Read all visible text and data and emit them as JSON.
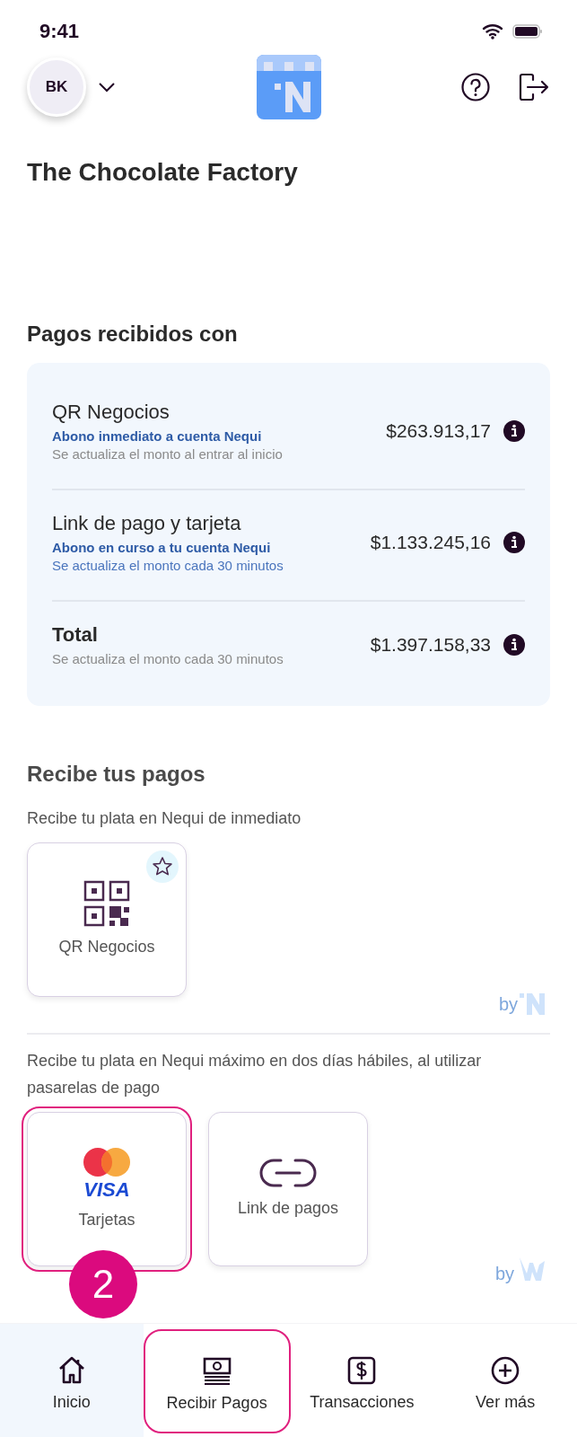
{
  "status_bar": {
    "time": "9:41"
  },
  "header": {
    "avatar_initials": "BK"
  },
  "business_name": "The Chocolate Factory",
  "payments": {
    "title": "Pagos recibidos con",
    "rows": [
      {
        "kind": "channel",
        "title": "QR Negocios",
        "amount": "$263.913,17",
        "notes": [
          {
            "text": "Abono inmediato a cuenta Nequi",
            "kind": "accent"
          },
          {
            "text": "Se actualiza el monto al entrar al inicio",
            "kind": "muted"
          }
        ]
      },
      {
        "kind": "channel",
        "title": "Link de pago y tarjeta",
        "amount": "$1.133.245,16",
        "notes": [
          {
            "text": "Abono en curso a tu cuenta Nequi",
            "kind": "accent"
          },
          {
            "text": "Se actualiza el monto cada 30 minutos",
            "kind": "link"
          }
        ]
      },
      {
        "kind": "total",
        "title": "Total",
        "amount": "$1.397.158,33",
        "notes": [
          {
            "text": "Se actualiza el monto cada 30 minutos",
            "kind": "muted"
          }
        ]
      }
    ]
  },
  "receive": {
    "title": "Recibe tus pagos",
    "groups": [
      {
        "description": "Recibe tu plata en Nequi de inmediato",
        "kind": "nequi",
        "by": "by",
        "options": [
          {
            "kind": "qr",
            "label": "QR Negocios",
            "favorite": true,
            "highlighted": false
          }
        ]
      },
      {
        "description": "Recibe tu plata en Nequi máximo en dos días hábiles, al utilizar pasarelas de pago",
        "kind": "wompi",
        "by": "by",
        "options": [
          {
            "kind": "cards",
            "label": "Tarjetas",
            "logo_text": "VISA",
            "favorite": false,
            "highlighted": true
          },
          {
            "kind": "link",
            "label": "Link de pagos",
            "favorite": false,
            "highlighted": false
          }
        ]
      }
    ]
  },
  "annotation": {
    "label": "2"
  },
  "bottom_nav": [
    {
      "kind": "home",
      "label": "Inicio",
      "selected": true,
      "highlighted": false
    },
    {
      "kind": "cash",
      "label": "Recibir Pagos",
      "selected": false,
      "highlighted": true
    },
    {
      "kind": "dollar",
      "label": "Transacciones",
      "selected": false,
      "highlighted": false
    },
    {
      "kind": "plus",
      "label": "Ver más",
      "selected": false,
      "highlighted": false
    }
  ]
}
